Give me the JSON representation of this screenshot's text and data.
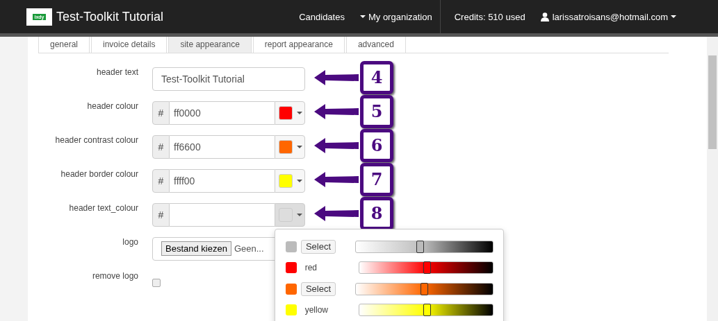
{
  "navbar": {
    "logo_text": "ixdy",
    "title": "Test-Toolkit Tutorial",
    "links": [
      {
        "label": "Candidates",
        "dropdown": false
      },
      {
        "label": "My organization",
        "dropdown": true
      }
    ],
    "credits": "Credits: 510 used",
    "user": "larissatroisans@hotmail.com"
  },
  "tabs": [
    {
      "label": "general",
      "selected": false
    },
    {
      "label": "invoice details",
      "selected": false
    },
    {
      "label": "site appearance",
      "selected": true
    },
    {
      "label": "report appearance",
      "selected": false
    },
    {
      "label": "advanced",
      "selected": false
    }
  ],
  "fields": [
    {
      "kind": "text",
      "label": "header text",
      "value": "Test-Toolkit Tutorial",
      "annotation": "4"
    },
    {
      "kind": "colour",
      "label": "header colour",
      "prefix": "#",
      "value": "ff0000",
      "color": "#ff0000",
      "annotation": "5",
      "open": false
    },
    {
      "kind": "colour",
      "label": "header contrast colour",
      "prefix": "#",
      "value": "ff6600",
      "color": "#ff6600",
      "annotation": "6",
      "open": false
    },
    {
      "kind": "colour",
      "label": "header border colour",
      "prefix": "#",
      "value": "ffff00",
      "color": "#ffff00",
      "annotation": "7",
      "open": false
    },
    {
      "kind": "colour",
      "label": "header text_colour",
      "prefix": "#",
      "color": "#dddddd",
      "annotation": "8",
      "open": true
    },
    {
      "kind": "file",
      "label": "logo",
      "button": "Bestand kiezen",
      "status": "Geen..."
    },
    {
      "kind": "checkbox",
      "label": "remove logo",
      "checked": false
    }
  ],
  "palette": [
    {
      "kind": "button",
      "color": "#bbbbbb",
      "label": "Select",
      "level": 0.47
    },
    {
      "kind": "text",
      "color": "#ff0000",
      "label": "red",
      "level": 0.51
    },
    {
      "kind": "button",
      "color": "#ff6600",
      "label": "Select",
      "level": 0.5
    },
    {
      "kind": "text",
      "color": "#ffff00",
      "label": "yellow",
      "level": 0.51
    }
  ]
}
